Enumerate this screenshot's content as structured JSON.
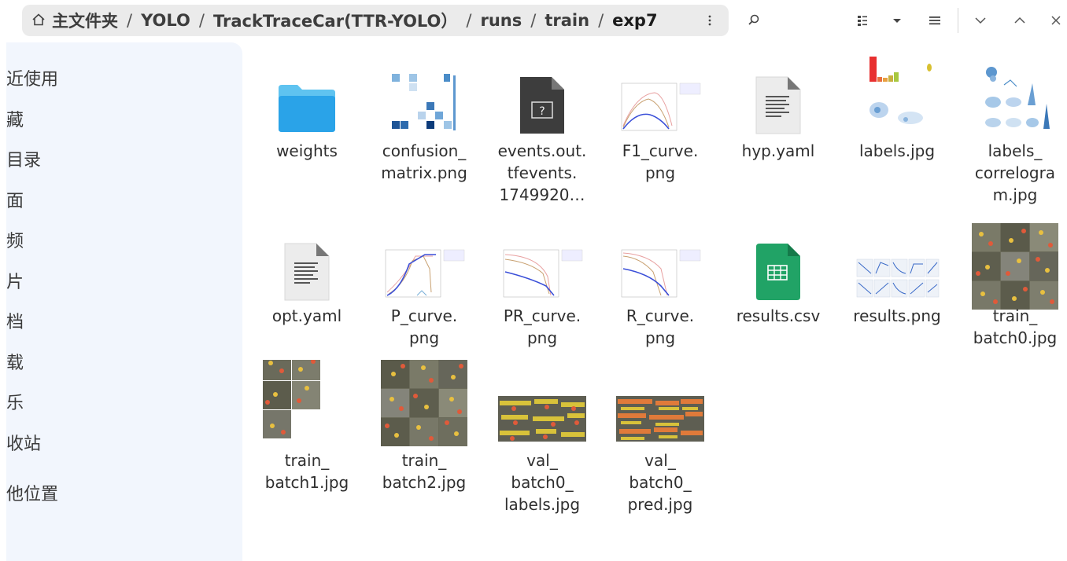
{
  "breadcrumb": {
    "home_label": "主文件夹",
    "segments": [
      "YOLO",
      "TrackTraceCar(TTR-YOLO）",
      "runs",
      "train"
    ],
    "current": "exp7",
    "separator": "/"
  },
  "sidebar": {
    "items": [
      {
        "label": "近使用"
      },
      {
        "label": "藏"
      },
      {
        "label": "目录"
      },
      {
        "label": "面"
      },
      {
        "label": "频"
      },
      {
        "label": "片"
      },
      {
        "label": "档"
      },
      {
        "label": "载"
      },
      {
        "label": "乐"
      },
      {
        "label": "收站"
      },
      {
        "label": "他位置"
      }
    ]
  },
  "files": [
    {
      "lines": [
        "weights"
      ],
      "icon": "folder-icon"
    },
    {
      "lines": [
        "confusion_",
        "matrix.png"
      ],
      "icon": "image-thumbnail"
    },
    {
      "lines": [
        "events.out.",
        "tfevents.",
        "1749920…"
      ],
      "icon": "unknown-file-icon"
    },
    {
      "lines": [
        "F1_curve.",
        "png"
      ],
      "icon": "image-thumbnail"
    },
    {
      "lines": [
        "hyp.yaml"
      ],
      "icon": "text-file-icon"
    },
    {
      "lines": [
        "labels.jpg"
      ],
      "icon": "image-thumbnail"
    },
    {
      "lines": [
        "labels_",
        "correlogra",
        "m.jpg"
      ],
      "icon": "image-thumbnail"
    },
    {
      "lines": [
        "opt.yaml"
      ],
      "icon": "text-file-icon"
    },
    {
      "lines": [
        "P_curve.",
        "png"
      ],
      "icon": "image-thumbnail"
    },
    {
      "lines": [
        "PR_curve.",
        "png"
      ],
      "icon": "image-thumbnail"
    },
    {
      "lines": [
        "R_curve.",
        "png"
      ],
      "icon": "image-thumbnail"
    },
    {
      "lines": [
        "results.csv"
      ],
      "icon": "spreadsheet-icon"
    },
    {
      "lines": [
        "results.png"
      ],
      "icon": "image-thumbnail"
    },
    {
      "lines": [
        "train_",
        "batch0.jpg"
      ],
      "icon": "image-thumbnail"
    },
    {
      "lines": [
        "train_",
        "batch1.jpg"
      ],
      "icon": "image-thumbnail"
    },
    {
      "lines": [
        "train_",
        "batch2.jpg"
      ],
      "icon": "image-thumbnail"
    },
    {
      "lines": [
        "val_",
        "batch0_",
        "labels.jpg"
      ],
      "icon": "image-thumbnail"
    },
    {
      "lines": [
        "val_",
        "batch0_",
        "pred.jpg"
      ],
      "icon": "image-thumbnail"
    }
  ],
  "colors": {
    "folder": "#3daee9",
    "spreadsheet": "#21a366",
    "sidebar_bg": "#f2f6fd",
    "pathbar_bg": "#ebebeb"
  }
}
